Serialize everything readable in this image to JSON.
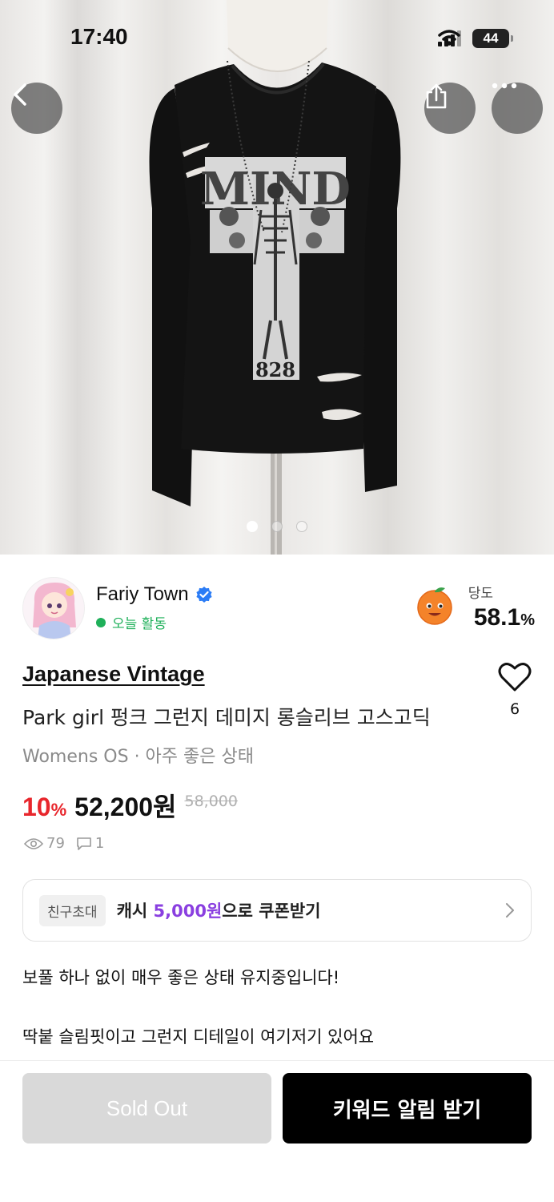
{
  "status_bar": {
    "time": "17:40",
    "battery": "44"
  },
  "hero": {
    "image_count": 3,
    "active_index": 0,
    "print_text": "828"
  },
  "seller": {
    "name": "Fariy Town",
    "activity": "오늘 활동",
    "sweetness_label": "당도",
    "sweetness_value": "58.1",
    "sweetness_unit": "%"
  },
  "product": {
    "brand": "Japanese Vintage",
    "title": "Park girl 펑크 그런지 데미지 롱슬리브 고스고딕",
    "meta": "Womens OS · 아주 좋은 상태",
    "likes": "6",
    "discount_value": "10",
    "discount_unit": "%",
    "price": "52,200원",
    "original_price": "58,000",
    "views": "79",
    "comments": "1"
  },
  "invite": {
    "tag": "친구초대",
    "text_prefix": "캐시 ",
    "amount": "5,000원",
    "text_suffix": "으로 쿠폰받기"
  },
  "description": [
    "보풀 하나 없이 매우 좋은 상태 유지중입니다!",
    "딱붙 슬림핏이고 그런지 디테일이 여기저기 있어요"
  ],
  "actions": {
    "sold_out": "Sold Out",
    "keyword_alert": "키워드 알림 받기"
  },
  "colors": {
    "discount": "#e8262c",
    "invite_amount": "#8a3fe0",
    "online": "#1fb05a",
    "verified": "#2b7cf6"
  }
}
